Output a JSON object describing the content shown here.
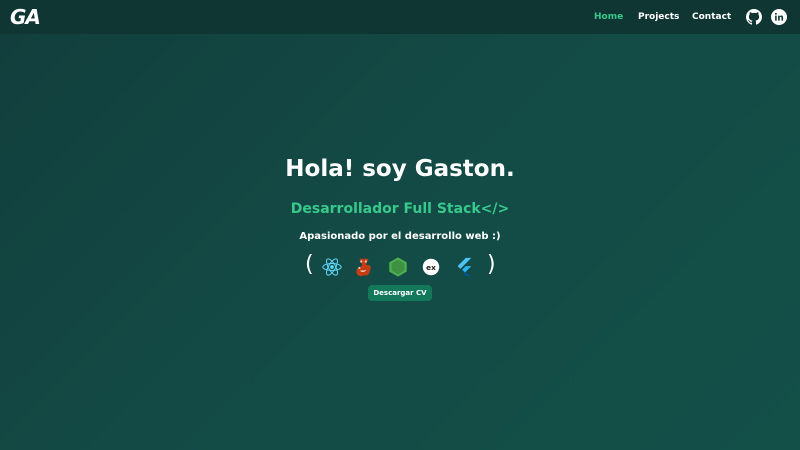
{
  "navbar": {
    "logo": "GA",
    "links": [
      {
        "label": "Home",
        "active": true
      },
      {
        "label": "Projects",
        "active": false
      },
      {
        "label": "Contact",
        "active": false
      }
    ],
    "social": [
      "github-icon",
      "linkedin-icon"
    ]
  },
  "hero": {
    "title": "Hola! soy Gaston.",
    "subtitle": "Desarrollador Full Stack</>",
    "description": "Apasionado por el desarrollo web :)",
    "tech_icons": [
      "react-icon",
      "jest-icon",
      "nodejs-icon",
      "express-icon",
      "flutter-icon"
    ],
    "bracket_open": "(",
    "bracket_close": ")",
    "cv_button": "Descargar CV"
  },
  "colors": {
    "accent": "#36c98b",
    "background": "#134a45",
    "navbar": "#103634",
    "button": "#13785a"
  }
}
